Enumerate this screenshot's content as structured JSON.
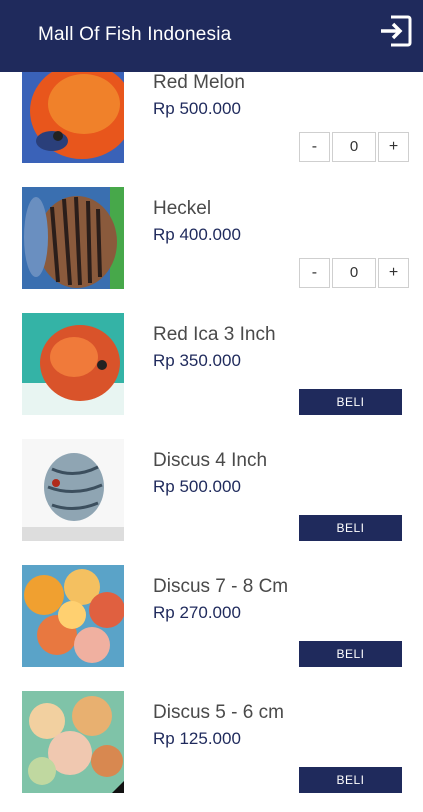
{
  "app": {
    "title": "Mall Of Fish Indonesia",
    "logout_icon": "logout-icon",
    "accent": "#1f2a5c"
  },
  "products": [
    {
      "name": "Red Melon",
      "price": "Rp 500.000",
      "control": "stepper",
      "qty": "0",
      "minus": "-",
      "plus": "+"
    },
    {
      "name": "Heckel",
      "price": "Rp 400.000",
      "control": "stepper",
      "qty": "0",
      "minus": "-",
      "plus": "+"
    },
    {
      "name": "Red Ica 3 Inch",
      "price": "Rp 350.000",
      "control": "button",
      "buy_label": "BELI"
    },
    {
      "name": "Discus 4 Inch",
      "price": "Rp 500.000",
      "control": "button",
      "buy_label": "BELI"
    },
    {
      "name": "Discus 7 - 8 Cm",
      "price": "Rp 270.000",
      "control": "button",
      "buy_label": "BELI"
    },
    {
      "name": "Discus 5 - 6 cm",
      "price": "Rp 125.000",
      "control": "button",
      "buy_label": "BELI"
    }
  ]
}
